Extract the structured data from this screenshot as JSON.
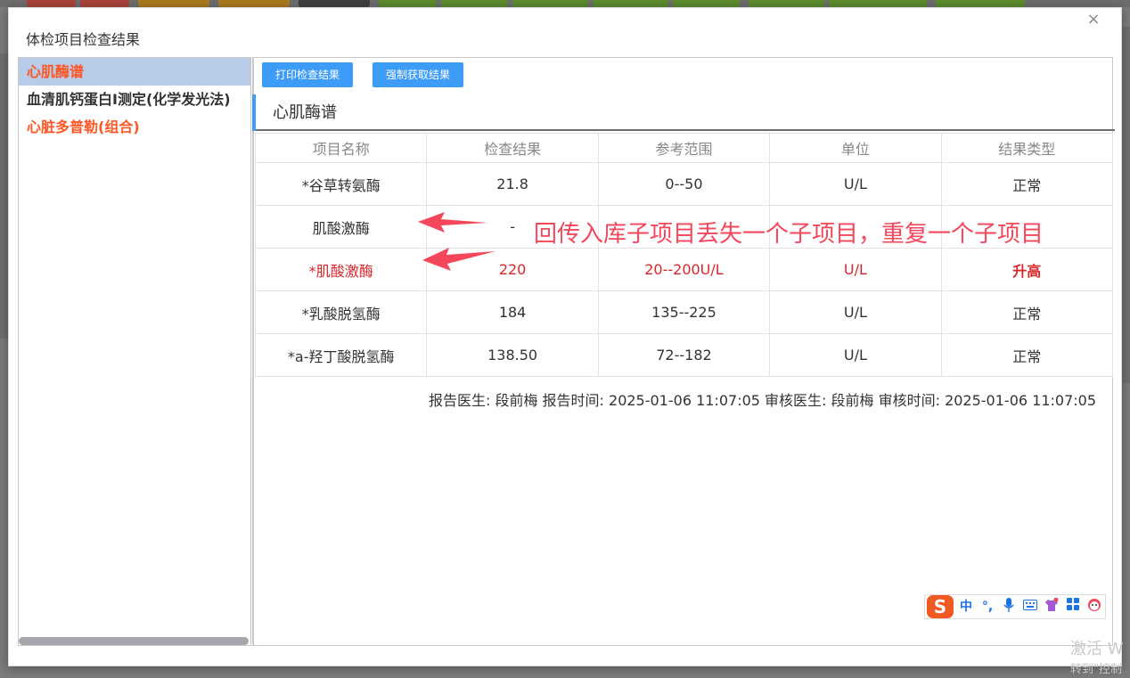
{
  "dialog": {
    "title": "体检项目检查结果",
    "close_glyph": "×"
  },
  "left_list": {
    "items": [
      {
        "label": "心肌酶谱"
      },
      {
        "label": "血清肌钙蛋白Ⅰ测定(化学发光法)"
      },
      {
        "label": "心脏多普勒(组合)"
      }
    ]
  },
  "toolbar": {
    "print_label": "打印检查结果",
    "fetch_label": "强制获取结果"
  },
  "section": {
    "title": "心肌酶谱"
  },
  "table": {
    "headers": [
      "项目名称",
      "检查结果",
      "参考范围",
      "单位",
      "结果类型"
    ],
    "rows": [
      {
        "name": "*谷草转氨酶",
        "result": "21.8",
        "range": "0--50",
        "unit": "U/L",
        "type": "正常"
      },
      {
        "name": "肌酸激酶",
        "result": "-",
        "range": "",
        "unit": "",
        "type": ""
      },
      {
        "name": "*肌酸激酶",
        "result": "220",
        "range": "20--200U/L",
        "unit": "U/L",
        "type": "升高"
      },
      {
        "name": "*乳酸脱氢酶",
        "result": "184",
        "range": "135--225",
        "unit": "U/L",
        "type": "正常"
      },
      {
        "name": "*a-羟丁酸脱氢酶",
        "result": "138.50",
        "range": "72--182",
        "unit": "U/L",
        "type": "正常"
      }
    ]
  },
  "footer": {
    "report_info": "报告医生: 段前梅 报告时间: 2025-01-06 11:07:05 审核医生: 段前梅 审核时间: 2025-01-06 11:07:05"
  },
  "annotation": {
    "text": "回传入库子项目丢失一个子项目，重复一个子项目",
    "color": "#f5475c"
  },
  "ime": {
    "logo": "S",
    "lang": "中",
    "punct": "°,",
    "icons": [
      "microphone-icon",
      "keyboard-icon",
      "shirt-icon",
      "apps-icon",
      "face-icon"
    ]
  },
  "watermark": {
    "line1": "激活 W",
    "line2": "转到\"控制"
  },
  "colors": {
    "accent": "#3d9cf5",
    "active_item_bg": "#b8cbe8",
    "highlight_text": "#ff5522",
    "abnormal_text": "#d9262b"
  }
}
